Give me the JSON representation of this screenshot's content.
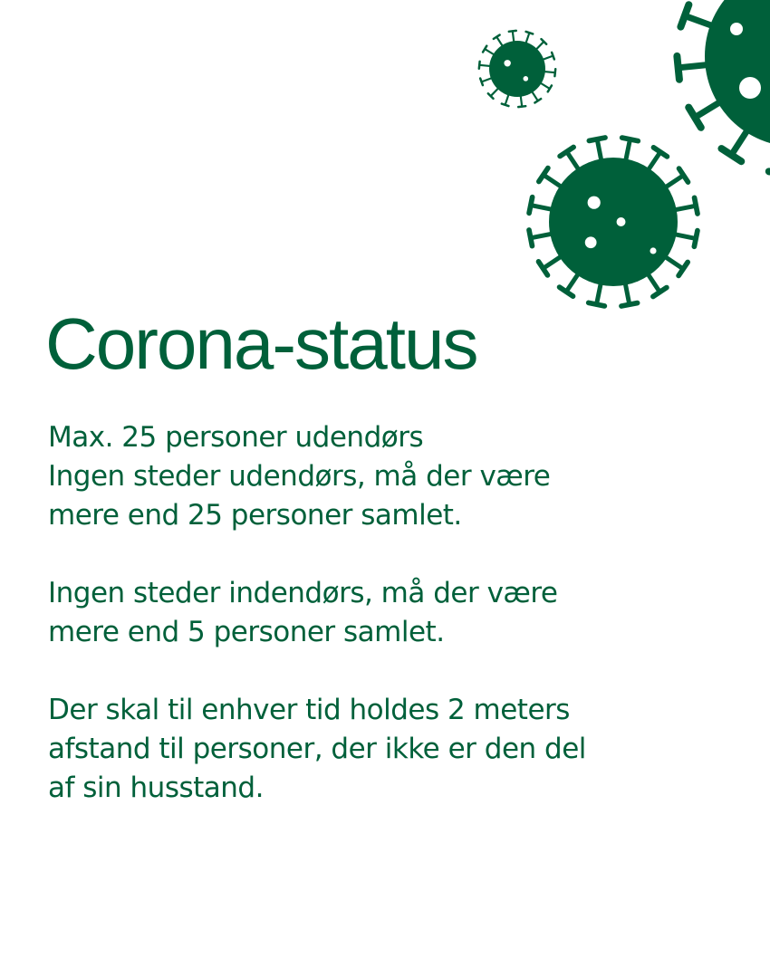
{
  "colors": {
    "brand_green": "#00603a",
    "background": "#ffffff"
  },
  "decoration": {
    "icon": "coronavirus-icon",
    "count": 3
  },
  "title": "Corona-status",
  "paragraphs": [
    {
      "lines": [
        "Max. 25 personer udendørs",
        "Ingen steder udendørs, må der være",
        "mere end 25 personer samlet."
      ]
    },
    {
      "lines": [
        "Ingen steder indendørs, må der være",
        "mere end 5 personer samlet."
      ]
    },
    {
      "lines": [
        "Der skal til enhver tid holdes 2 meters",
        "afstand til personer, der ikke er den del",
        "af sin husstand."
      ]
    }
  ]
}
